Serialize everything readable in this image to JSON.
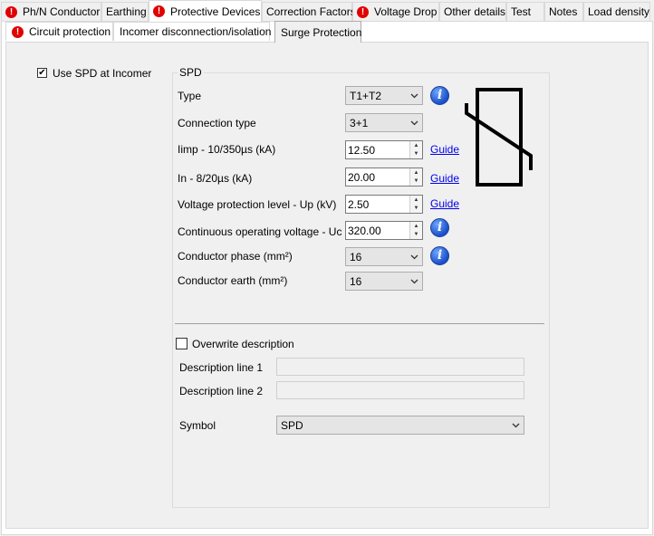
{
  "tabs_top": [
    {
      "label": "Ph/N Conductor",
      "error": true
    },
    {
      "label": "Earthing",
      "error": false
    },
    {
      "label": "Protective Devices",
      "error": true,
      "active": true
    },
    {
      "label": "Correction Factors",
      "error": false
    },
    {
      "label": "Voltage Drop",
      "error": true
    },
    {
      "label": "Other details",
      "error": false
    },
    {
      "label": "Test",
      "error": false
    },
    {
      "label": "Notes",
      "error": false
    },
    {
      "label": "Load density",
      "error": false
    }
  ],
  "tabs_sub": [
    {
      "label": "Circuit protection",
      "error": true
    },
    {
      "label": "Incomer disconnection/isolation",
      "error": false
    },
    {
      "label": "Surge Protection",
      "error": false,
      "active": true
    }
  ],
  "error_glyph": "!",
  "use_spd": {
    "label": "Use SPD at Incomer",
    "checked": true,
    "mark": "✔"
  },
  "spd": {
    "group_title": "SPD",
    "type": {
      "label": "Type",
      "value": "T1+T2"
    },
    "connection_type": {
      "label": "Connection type",
      "value": "3+1"
    },
    "imp": {
      "label": "Iimp - 10/350µs (kA)",
      "value": "12.50",
      "guide": "Guide"
    },
    "in": {
      "label": "In - 8/20µs (kA)",
      "value": "20.00",
      "guide": "Guide"
    },
    "up": {
      "label": "Voltage protection level - Up (kV)",
      "value": "2.50",
      "guide": "Guide"
    },
    "uc": {
      "label": "Continuous operating voltage - Uc (V)",
      "value": "320.00"
    },
    "cond_phase": {
      "label": "Conductor phase (mm²)",
      "value": "16"
    },
    "cond_earth": {
      "label": "Conductor earth (mm²)",
      "value": "16"
    },
    "info_glyph": "i",
    "spin_up": "▲",
    "spin_down": "▼"
  },
  "description": {
    "overwrite_label": "Overwrite description",
    "overwrite_checked": false,
    "line1_label": "Description line 1",
    "line1_value": "",
    "line2_label": "Description line 2",
    "line2_value": "",
    "symbol_label": "Symbol",
    "symbol_value": "SPD"
  },
  "colors": {
    "error": "#e00000",
    "info": "#1a4fc9",
    "link": "#0000ee"
  }
}
